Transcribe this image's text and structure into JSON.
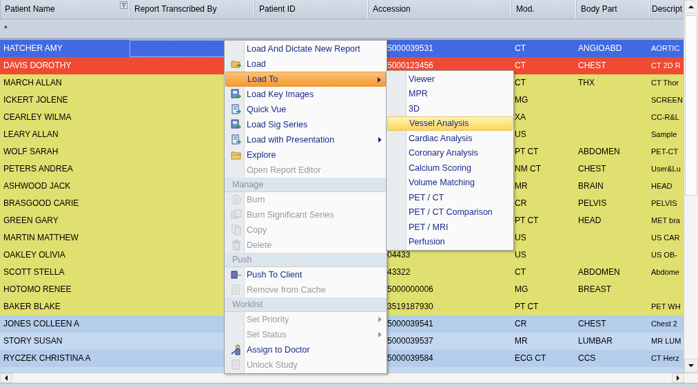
{
  "columns": [
    {
      "label": "Patient Name",
      "filter": true
    },
    {
      "label": "Report Transcribed By",
      "filter": false
    },
    {
      "label": "Patient ID",
      "filter": false
    },
    {
      "label": "Accession",
      "filter": false
    },
    {
      "label": "Mod.",
      "filter": false
    },
    {
      "label": "Body Part",
      "filter": false
    },
    {
      "label": "Descript",
      "filter": false
    }
  ],
  "filter_row": {
    "text": "*"
  },
  "rows": [
    {
      "name": "HATCHER AMY",
      "accession": "5000039531",
      "mod": "CT",
      "body_part": "ANGIOABD",
      "description": "AORTIC",
      "color": "#4169e1",
      "selected": true
    },
    {
      "name": "DAVIS DOROTHY",
      "accession": "5000123456",
      "mod": "CT",
      "body_part": "CHEST",
      "description": "CT 2D R",
      "color": "#f04a32",
      "selected": false
    },
    {
      "name": "MARCH ALLAN",
      "mod": "CT",
      "body_part": "THX",
      "description": "CT Thor",
      "color": "#e0e070",
      "selected": false
    },
    {
      "name": "ICKERT JOLENE",
      "mod": "MG",
      "description": "SCREEN",
      "color": "#e0e070",
      "selected": false
    },
    {
      "name": "CEARLEY WILMA",
      "mod": "XA",
      "description": "CC-R&L",
      "color": "#e0e070",
      "selected": false
    },
    {
      "name": "LEARY ALLAN",
      "mod": "US",
      "description": "Sample",
      "color": "#e0e070",
      "selected": false
    },
    {
      "name": "WOLF SARAH",
      "mod": "PT CT",
      "body_part": "ABDOMEN",
      "description": "PET-CT",
      "color": "#e0e070",
      "selected": false
    },
    {
      "name": "PETERS ANDREA",
      "mod": "NM CT",
      "body_part": "CHEST",
      "description": "User&Lu",
      "color": "#e0e070",
      "selected": false
    },
    {
      "name": "ASHWOOD JACK",
      "mod": "MR",
      "body_part": "BRAIN",
      "description": "HEAD",
      "color": "#e0e070",
      "selected": false
    },
    {
      "name": "BRASGOOD CARIE",
      "mod": "CR",
      "body_part": "PELVIS",
      "description": "PELVIS",
      "color": "#e0e070",
      "selected": false
    },
    {
      "name": "GREEN GARY",
      "mod": "PT CT",
      "body_part": "HEAD",
      "description": "MET bra",
      "color": "#e0e070",
      "selected": false
    },
    {
      "name": "MARTIN MATTHEW",
      "mod": "US",
      "description": "US CAR",
      "color": "#e0e070",
      "selected": false
    },
    {
      "name": "OAKLEY OLIVIA",
      "accession": "04433",
      "mod": "US",
      "description": "US OB-",
      "color": "#e0e070",
      "selected": false
    },
    {
      "name": "SCOTT STELLA",
      "accession": "43322",
      "mod": "CT",
      "body_part": "ABDOMEN",
      "description": "Abdome",
      "color": "#e0e070",
      "selected": false
    },
    {
      "name": "HOTOMO RENEE",
      "accession": "5000000006",
      "mod": "MG",
      "body_part": "BREAST",
      "color": "#e0e070",
      "selected": false
    },
    {
      "name": "BAKER BLAKE",
      "accession": "3519187930",
      "mod": "PT CT",
      "description": "PET WH",
      "color": "#e0e070",
      "selected": false
    },
    {
      "name": "JONES COLLEEN A",
      "accession": "5000039541",
      "mod": "CR",
      "body_part": "CHEST",
      "description": "Chest 2",
      "color": "#b4cdea",
      "selected": false
    },
    {
      "name": "STORY SUSAN",
      "accession": "5000039537",
      "mod": "MR",
      "body_part": "LUMBAR",
      "description": "MR LUM",
      "color": "#c4d8f0",
      "selected": false
    },
    {
      "name": "RYCZEK CHRISTINA A",
      "accession": "5000039584",
      "mod": "ECG CT",
      "body_part": "CCS",
      "description": "CT Herz",
      "color": "#b4cdea",
      "selected": false
    },
    {
      "color": "#c4d8f0",
      "selected": false
    }
  ],
  "context_menu": {
    "items": [
      {
        "kind": "item",
        "label": "Load And Dictate New Report",
        "disabled": false,
        "selected": false,
        "submenu": false
      },
      {
        "kind": "item",
        "label": "Load",
        "disabled": false,
        "selected": false,
        "submenu": false
      },
      {
        "kind": "item",
        "label": "Load To",
        "disabled": false,
        "selected": true,
        "submenu": true
      },
      {
        "kind": "item",
        "label": "Load Key Images",
        "disabled": false,
        "selected": false,
        "submenu": false
      },
      {
        "kind": "item",
        "label": "Quick Vue",
        "disabled": false,
        "selected": false,
        "submenu": false
      },
      {
        "kind": "item",
        "label": "Load Sig Series",
        "disabled": false,
        "selected": false,
        "submenu": false
      },
      {
        "kind": "item",
        "label": "Load with Presentation",
        "disabled": false,
        "selected": false,
        "submenu": true
      },
      {
        "kind": "item",
        "label": "Explore",
        "disabled": false,
        "selected": false,
        "submenu": false
      },
      {
        "kind": "item",
        "label": "Open Report Editor",
        "disabled": true,
        "selected": false,
        "submenu": false
      },
      {
        "kind": "header",
        "label": "Manage"
      },
      {
        "kind": "item",
        "label": "Burn",
        "disabled": true,
        "selected": false,
        "submenu": false
      },
      {
        "kind": "item",
        "label": "Burn Significant Series",
        "disabled": true,
        "selected": false,
        "submenu": false
      },
      {
        "kind": "item",
        "label": "Copy",
        "disabled": true,
        "selected": false,
        "submenu": false
      },
      {
        "kind": "item",
        "label": "Delete",
        "disabled": true,
        "selected": false,
        "submenu": false
      },
      {
        "kind": "header",
        "label": "Push"
      },
      {
        "kind": "item",
        "label": "Push To Client",
        "disabled": false,
        "selected": false,
        "submenu": false
      },
      {
        "kind": "item",
        "label": "Remove from Cache",
        "disabled": true,
        "selected": false,
        "submenu": false
      },
      {
        "kind": "header",
        "label": "Worklist"
      },
      {
        "kind": "item",
        "label": "Set Priority",
        "disabled": true,
        "selected": false,
        "submenu": true
      },
      {
        "kind": "item",
        "label": "Set Status",
        "disabled": true,
        "selected": false,
        "submenu": true
      },
      {
        "kind": "item",
        "label": "Assign to Doctor",
        "disabled": false,
        "selected": false,
        "submenu": false
      },
      {
        "kind": "item",
        "label": "Unlock Study",
        "disabled": true,
        "selected": false,
        "submenu": false
      }
    ]
  },
  "submenu": {
    "items": [
      {
        "label": "Viewer",
        "selected": false
      },
      {
        "label": "MPR",
        "selected": false
      },
      {
        "label": "3D",
        "selected": false
      },
      {
        "label": "Vessel Analysis",
        "selected": true
      },
      {
        "label": "Cardiac Analysis",
        "selected": false
      },
      {
        "label": "Coronary Analysis",
        "selected": false
      },
      {
        "label": "Calcium Scoring",
        "selected": false
      },
      {
        "label": "Volume Matching",
        "selected": false
      },
      {
        "label": "PET / CT",
        "selected": false
      },
      {
        "label": "PET / CT Comparison",
        "selected": false
      },
      {
        "label": "PET / MRI",
        "selected": false
      },
      {
        "label": "Perfusion",
        "selected": false
      }
    ]
  }
}
